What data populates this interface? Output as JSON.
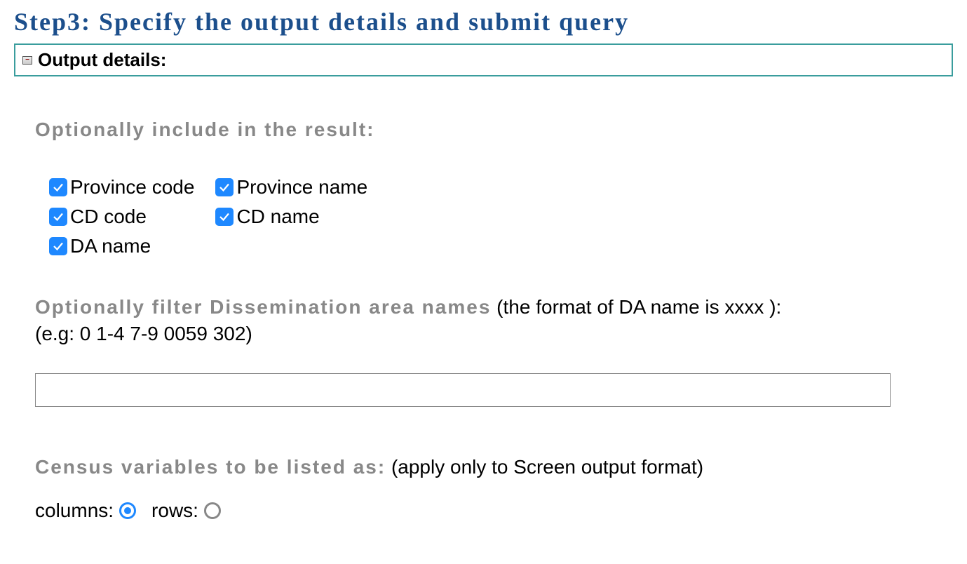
{
  "step_title": "Step3: Specify the output details and submit query",
  "header": {
    "label": "Output details:"
  },
  "include_section": {
    "label": "Optionally include in the result:",
    "checkboxes": {
      "province_code": {
        "label": "Province code",
        "checked": true
      },
      "province_name": {
        "label": "Province name",
        "checked": true
      },
      "cd_code": {
        "label": "CD code",
        "checked": true
      },
      "cd_name": {
        "label": "CD name",
        "checked": true
      },
      "da_name": {
        "label": "DA name",
        "checked": true
      }
    }
  },
  "filter_section": {
    "label": "Optionally filter Dissemination area names",
    "hint": " (the format of DA name is xxxx ):",
    "example": "(e.g: 0 1-4 7-9 0059 302)",
    "value": ""
  },
  "census_section": {
    "label": "Census variables to be listed as:",
    "hint": " (apply only to Screen output format)",
    "options": {
      "columns": {
        "label": "columns:",
        "selected": true
      },
      "rows": {
        "label": "rows:",
        "selected": false
      }
    }
  }
}
